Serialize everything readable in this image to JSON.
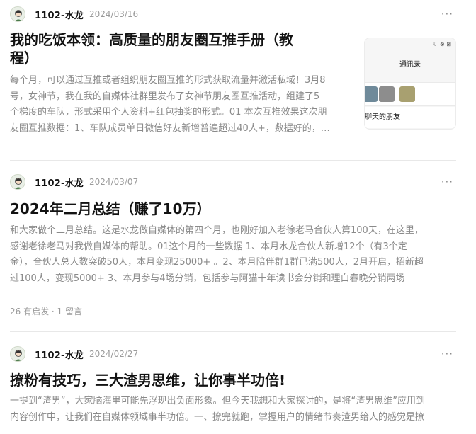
{
  "posts": [
    {
      "author": "1102-水龙",
      "date": "2024/03/16",
      "more": "···",
      "title_line1": "我的吃饭本领：高质量的朋友圈互推手册（教",
      "title_line2": "程）",
      "excerpt_lines": [
        "每个月，可以通过互推或者组织朋友圈互推的形式获取流量并激活私域！3月8",
        "号，女神节，我在我的自媒体社群里发布了女神节朋友圈互推活动，组建了5",
        "个梯度的车队，形式采用个人资料+红包抽奖的形式。01 本次互推效果这次朋",
        "友圈互推数据：1、车队成员单日微信好友新增普遍超过40人+，数据好的，…"
      ],
      "thumbnail": {
        "status_icons": "☾ ⊗ ⊠",
        "contacts_title": "通讯录",
        "friends_label": "聊天的朋友"
      }
    },
    {
      "author": "1102-水龙",
      "date": "2024/03/07",
      "more": "···",
      "title_line1": "2024年二月总结（赚了10万）",
      "excerpt_lines": [
        "和大家做个二月总结。这是水龙做自媒体的第四个月，也刚好加入老徐老马合伙人第100天，在这里，",
        "感谢老徐老马对我做自媒体的帮助。01这个月的一些数据 1、本月水龙合伙人新增12个（有3个定",
        "金），合伙人总人数突破50人，本月变现25000+ 。2、本月陪伴群1群已满500人，2月开启，招新超",
        "过100人，变现5000+ 3、本月参与4场分销，包括参与阿猫十年读书会分销和理白春晚分销两场"
      ],
      "stats": "26 有启发 · 1 留言"
    },
    {
      "author": "1102-水龙",
      "date": "2024/02/27",
      "more": "···",
      "title_line1": "撩粉有技巧，三大渣男思维，让你事半功倍!",
      "excerpt_lines": [
        "一提到“渣男”，大家脑海里可能先浮现出负面形象。但今天我想和大家探讨的，是将“渣男思维”应用到",
        "内容创作中，让我们在自媒体领域事半功倍。一、撩完就跑，掌握用户的情绪节奏渣男给人的感觉是撩"
      ]
    }
  ]
}
